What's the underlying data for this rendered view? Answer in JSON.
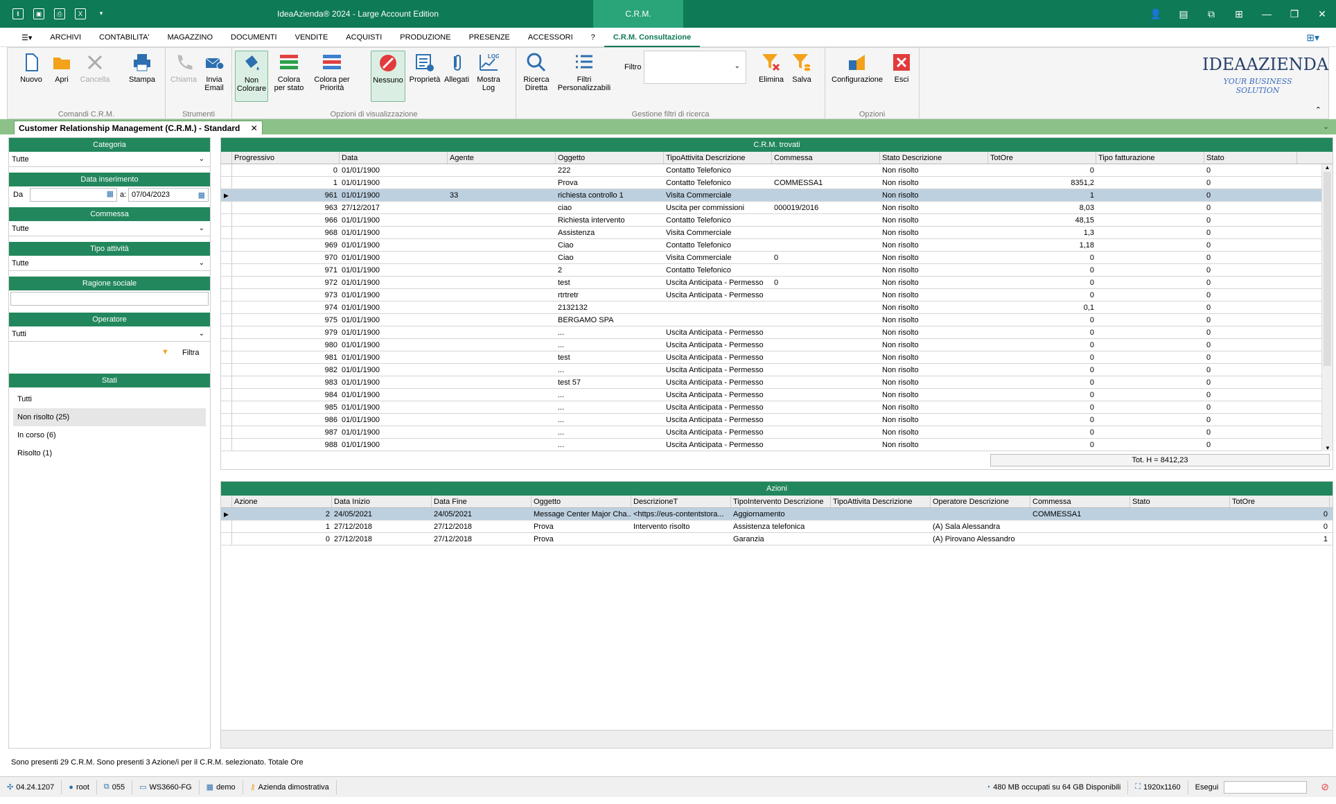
{
  "titlebar": {
    "title": "IdeaAzienda® 2024 - Large Account Edition",
    "tab": "C.R.M."
  },
  "menu": [
    "ARCHIVI",
    "CONTABILITA'",
    "MAGAZZINO",
    "DOCUMENTI",
    "VENDITE",
    "ACQUISTI",
    "PRODUZIONE",
    "PRESENZE",
    "ACCESSORI",
    "?",
    "C.R.M. Consultazione"
  ],
  "ribbon": {
    "g1": {
      "label": "Comandi C.R.M.",
      "nuovo": "Nuovo",
      "apri": "Apri",
      "cancella": "Cancella",
      "stampa": "Stampa"
    },
    "g2": {
      "label": "Strumenti",
      "chiama": "Chiama",
      "invia1": "Invia",
      "invia2": "Email"
    },
    "g3": {
      "label": "Opzioni di visualizzazione",
      "non1": "Non",
      "non2": "Colorare",
      "cs1": "Colora",
      "cs2": "per stato",
      "cp1": "Colora per",
      "cp2": "Priorità",
      "nessuno": "Nessuno",
      "proprieta": "Proprietà",
      "allegati": "Allegati",
      "ml1": "Mostra",
      "ml2": "Log"
    },
    "g4": {
      "label": "Gestione filtri di ricerca",
      "rd1": "Ricerca",
      "rd2": "Diretta",
      "fp1": "Filtri",
      "fp2": "Personalizzabili",
      "filtro": "Filtro",
      "elimina": "Elimina",
      "salva": "Salva"
    },
    "g5": {
      "label": "Opzioni",
      "config": "Configurazione",
      "esci": "Esci"
    },
    "logo1": "IDEAAZIENDA",
    "logo2": "YOUR BUSINESS SOLUTION"
  },
  "doctab": "Customer Relationship Management (C.R.M.) - Standard",
  "filters": {
    "categoria": "Categoria",
    "categoria_val": "Tutte",
    "data_ins": "Data inserimento",
    "da": "Da",
    "a": "a:",
    "a_val": "07/04/2023",
    "commessa": "Commessa",
    "commessa_val": "Tutte",
    "tipo": "Tipo attività",
    "tipo_val": "Tutte",
    "ragione": "Ragione sociale",
    "operatore": "Operatore",
    "operatore_val": "Tutti",
    "filtra": "Filtra",
    "stati": "Stati",
    "stati_list": [
      "Tutti",
      "Non risolto (25)",
      "In corso (6)",
      "Risolto (1)"
    ]
  },
  "crm": {
    "title": "C.R.M. trovati",
    "columns": [
      "Progressivo",
      "Data",
      "Agente",
      "Oggetto",
      "TipoAttivita Descrizione",
      "Commessa",
      "Stato Descrizione",
      "TotOre",
      "Tipo fatturazione",
      "Stato"
    ],
    "rows": [
      [
        "0",
        "01/01/1900",
        "",
        "222",
        "Contatto Telefonico",
        "",
        "Non risolto",
        "0",
        "",
        "0"
      ],
      [
        "1",
        "01/01/1900",
        "",
        "Prova",
        "Contatto Telefonico",
        "COMMESSA1",
        "Non risolto",
        "8351,2",
        "",
        "0"
      ],
      [
        "961",
        "01/01/1900",
        "33",
        "richiesta controllo 1",
        "Visita Commerciale",
        "",
        "Non risolto",
        "1",
        "",
        "0"
      ],
      [
        "963",
        "27/12/2017",
        "",
        "ciao",
        "Uscita per commissioni",
        "000019/2016",
        "Non risolto",
        "8,03",
        "",
        "0"
      ],
      [
        "966",
        "01/01/1900",
        "",
        "Richiesta intervento",
        "Contatto Telefonico",
        "",
        "Non risolto",
        "48,15",
        "",
        "0"
      ],
      [
        "968",
        "01/01/1900",
        "",
        "Assistenza",
        "Visita Commerciale",
        "",
        "Non risolto",
        "1,3",
        "",
        "0"
      ],
      [
        "969",
        "01/01/1900",
        "",
        "Ciao",
        "Contatto Telefonico",
        "",
        "Non risolto",
        "1,18",
        "",
        "0"
      ],
      [
        "970",
        "01/01/1900",
        "",
        "Ciao",
        "Visita Commerciale",
        "0",
        "Non risolto",
        "0",
        "",
        "0"
      ],
      [
        "971",
        "01/01/1900",
        "",
        "2",
        "Contatto Telefonico",
        "",
        "Non risolto",
        "0",
        "",
        "0"
      ],
      [
        "972",
        "01/01/1900",
        "",
        "test",
        "Uscita Anticipata - Permesso",
        "0",
        "Non risolto",
        "0",
        "",
        "0"
      ],
      [
        "973",
        "01/01/1900",
        "",
        "rtrtretr",
        "Uscita Anticipata - Permesso",
        "",
        "Non risolto",
        "0",
        "",
        "0"
      ],
      [
        "974",
        "01/01/1900",
        "",
        "2132132",
        "",
        "",
        "Non risolto",
        "0,1",
        "",
        "0"
      ],
      [
        "975",
        "01/01/1900",
        "",
        "BERGAMO SPA",
        "",
        "",
        "Non risolto",
        "0",
        "",
        "0"
      ],
      [
        "979",
        "01/01/1900",
        "",
        "...",
        "Uscita Anticipata - Permesso",
        "",
        "Non risolto",
        "0",
        "",
        "0"
      ],
      [
        "980",
        "01/01/1900",
        "",
        "...",
        "Uscita Anticipata - Permesso",
        "",
        "Non risolto",
        "0",
        "",
        "0"
      ],
      [
        "981",
        "01/01/1900",
        "",
        "test",
        "Uscita Anticipata - Permesso",
        "",
        "Non risolto",
        "0",
        "",
        "0"
      ],
      [
        "982",
        "01/01/1900",
        "",
        "...",
        "Uscita Anticipata - Permesso",
        "",
        "Non risolto",
        "0",
        "",
        "0"
      ],
      [
        "983",
        "01/01/1900",
        "",
        "test 57",
        "Uscita Anticipata - Permesso",
        "",
        "Non risolto",
        "0",
        "",
        "0"
      ],
      [
        "984",
        "01/01/1900",
        "",
        "...",
        "Uscita Anticipata - Permesso",
        "",
        "Non risolto",
        "0",
        "",
        "0"
      ],
      [
        "985",
        "01/01/1900",
        "",
        "...",
        "Uscita Anticipata - Permesso",
        "",
        "Non risolto",
        "0",
        "",
        "0"
      ],
      [
        "986",
        "01/01/1900",
        "",
        "...",
        "Uscita Anticipata - Permesso",
        "",
        "Non risolto",
        "0",
        "",
        "0"
      ],
      [
        "987",
        "01/01/1900",
        "",
        "...",
        "Uscita Anticipata - Permesso",
        "",
        "Non risolto",
        "0",
        "",
        "0"
      ],
      [
        "988",
        "01/01/1900",
        "",
        "...",
        "Uscita Anticipata - Permesso",
        "",
        "Non risolto",
        "0",
        "",
        "0"
      ]
    ],
    "total": "Tot. H = 8412,23"
  },
  "azioni": {
    "title": "Azioni",
    "columns": [
      "Azione",
      "Data Inizio",
      "Data Fine",
      "Oggetto",
      "DescrizioneT",
      "TipoIntervento Descrizione",
      "TipoAttivita Descrizione",
      "Operatore Descrizione",
      "Commessa",
      "Stato",
      "TotOre"
    ],
    "rows": [
      [
        "2",
        "24/05/2021",
        "24/05/2021",
        "Message Center Major Cha...",
        "<https://eus-contentstora...",
        "Aggiornamento",
        "",
        "",
        "COMMESSA1",
        "",
        "0"
      ],
      [
        "1",
        "27/12/2018",
        "27/12/2018",
        "Prova",
        "Intervento risolto",
        "Assistenza telefonica",
        "",
        "(A) Sala Alessandra",
        "",
        "",
        "0"
      ],
      [
        "0",
        "27/12/2018",
        "27/12/2018",
        "Prova",
        "",
        "Garanzia",
        "",
        "(A) Pirovano Alessandro",
        "",
        "",
        "1"
      ]
    ]
  },
  "statusline": "Sono presenti 29 C.R.M.   Sono presenti 3 Azione/i per il C.R.M. selezionato.   Totale Ore",
  "bottom": {
    "version": "04.24.1207",
    "user": "root",
    "code": "055",
    "ws": "WS3660-FG",
    "db": "demo",
    "azienda": "Azienda dimostrativa",
    "mem": "480 MB occupati su 64 GB Disponibili",
    "res": "1920x1160",
    "esegui": "Esegui"
  }
}
